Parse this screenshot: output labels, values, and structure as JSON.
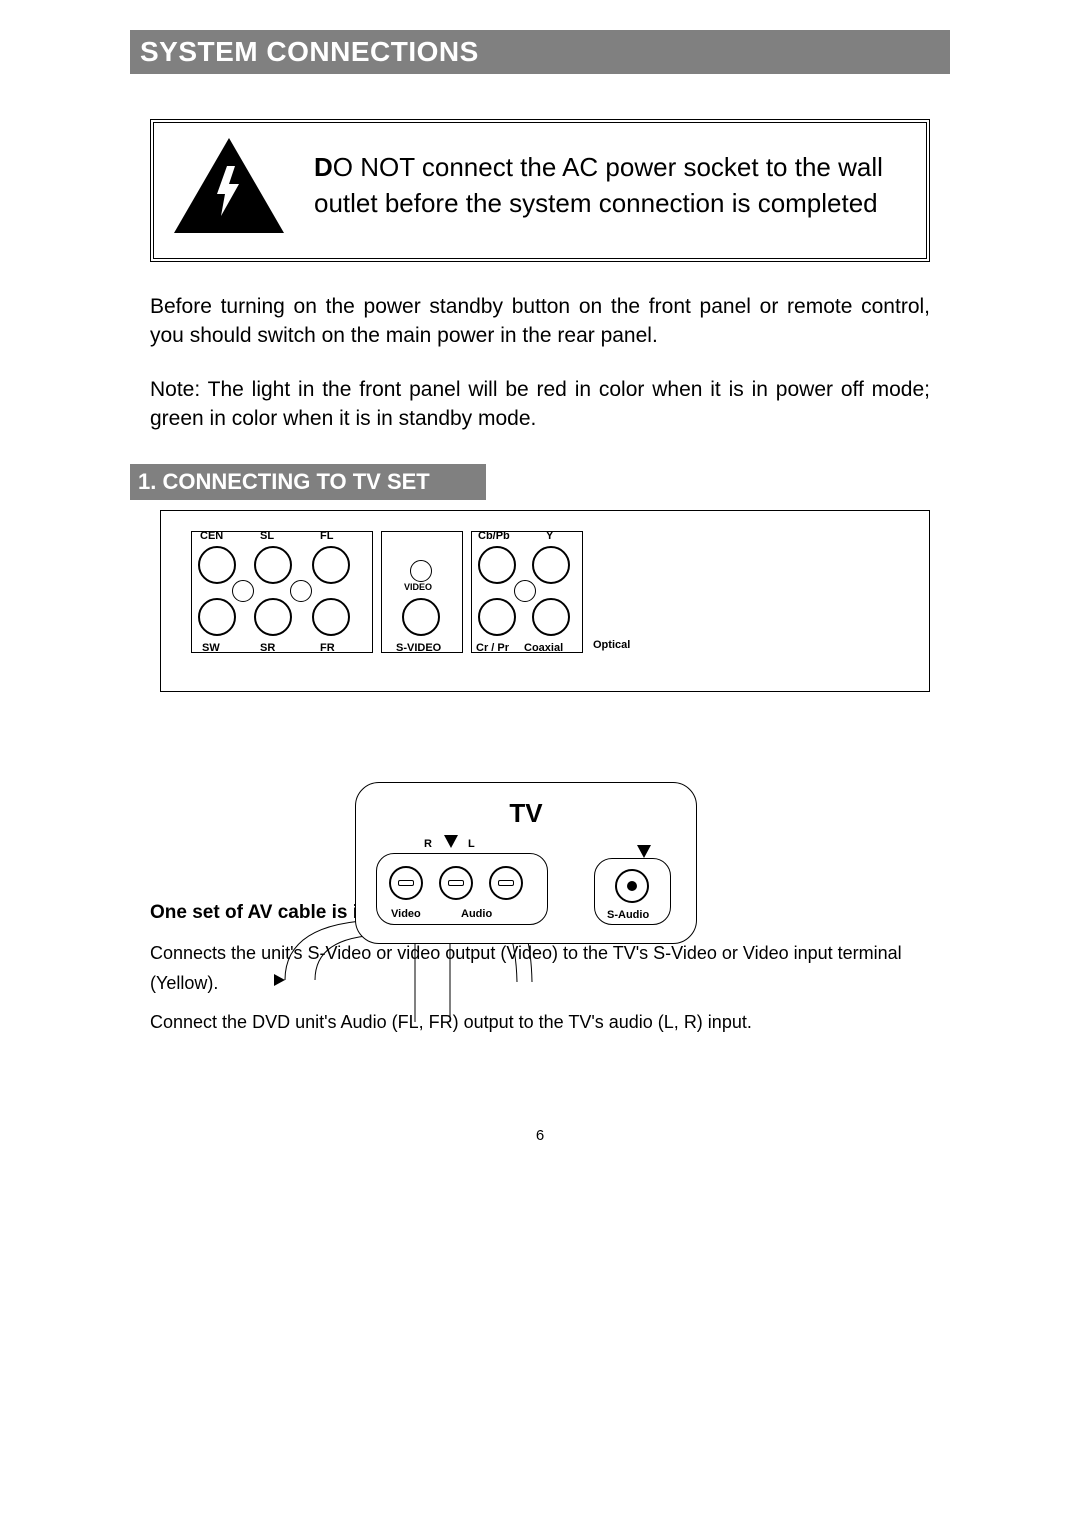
{
  "title": "SYSTEM CONNECTIONS",
  "warning_text": "O NOT connect the AC power socket to the wall outlet before the system connection is completed",
  "warning_lead": "D",
  "para1": "Before turning on the power standby button on the front panel or remote control, you should switch on the main power in the rear panel.",
  "para2": "Note: The light in the front panel will be red in color when it is in power off mode; green in color when it is in standby mode.",
  "sub_heading": "1. CONNECTING TO TV SET",
  "rear_labels": {
    "cen": "CEN",
    "sl": "SL",
    "fl": "FL",
    "sw": "SW",
    "sr": "SR",
    "fr": "FR",
    "video": "VIDEO",
    "svideo": "S-VIDEO",
    "cbpb": "Cb/Pb",
    "y": "Y",
    "crpr": "Cr / Pr",
    "coax": "Coaxial",
    "opt": "Optical"
  },
  "tv": {
    "title": "TV",
    "r": "R",
    "l": "L",
    "video": "Video",
    "audio": "Audio",
    "saudio": "S-Audio"
  },
  "packing_bold": "One set of AV cable is included in the Standard packing",
  "connect1": "Connects the unit's S-Video or video output (Video) to the TV's S-Video or Video input terminal (Yellow).",
  "connect2": "Connect the DVD unit's Audio (FL, FR) output to the TV's audio (L, R) input.",
  "page_number": "6"
}
